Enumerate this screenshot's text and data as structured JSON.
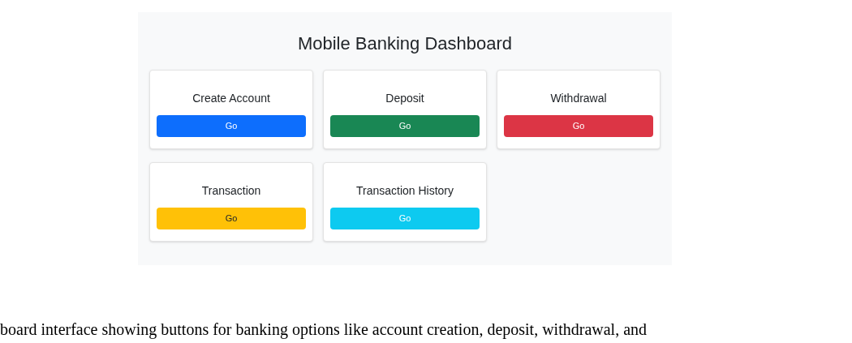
{
  "dashboard": {
    "title": "Mobile Banking Dashboard",
    "cards": [
      {
        "title": "Create Account",
        "button": "Go",
        "color": "#0d6efd"
      },
      {
        "title": "Deposit",
        "button": "Go",
        "color": "#198754"
      },
      {
        "title": "Withdrawal",
        "button": "Go",
        "color": "#dc3545"
      },
      {
        "title": "Transaction",
        "button": "Go",
        "color": "#ffc107"
      },
      {
        "title": "Transaction History",
        "button": "Go",
        "color": "#0dcaf0"
      }
    ]
  },
  "caption": "board interface showing buttons for banking options like account creation, deposit, withdrawal, and"
}
